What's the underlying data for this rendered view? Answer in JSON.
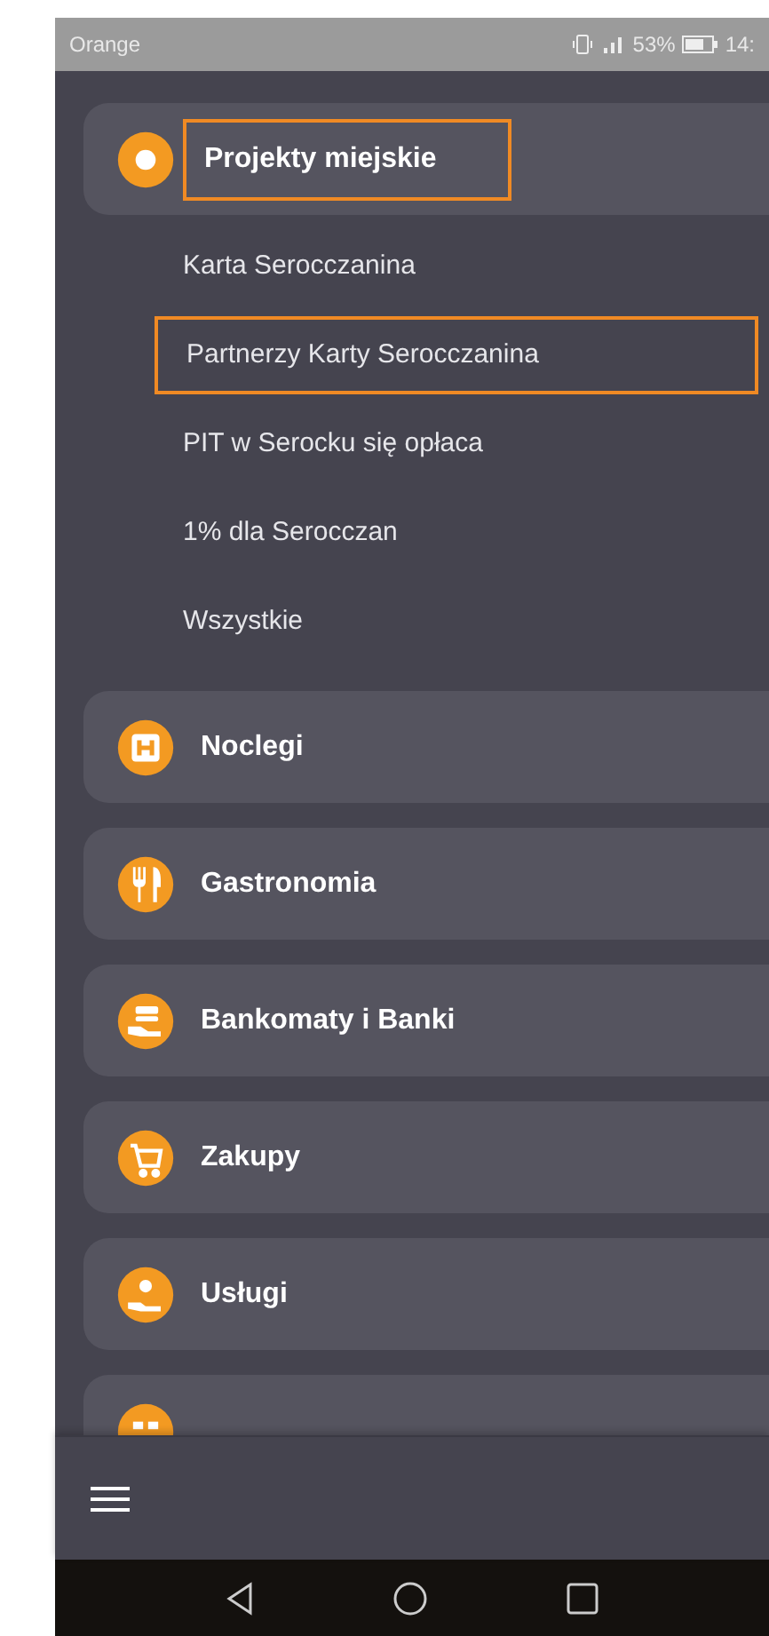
{
  "status_bar": {
    "carrier": "Orange",
    "battery": "53%",
    "time": "14:"
  },
  "categories": [
    {
      "kind": "target",
      "label": "Projekty miejskie",
      "highlighted": true,
      "children": [
        {
          "label": "Karta Serocczanina",
          "highlighted": false
        },
        {
          "label": "Partnerzy Karty Serocczanina",
          "highlighted": true
        },
        {
          "label": "PIT w Serocku się opłaca",
          "highlighted": false
        },
        {
          "label": "1% dla Serocczan",
          "highlighted": false
        },
        {
          "label": "Wszystkie",
          "highlighted": false
        }
      ]
    },
    {
      "kind": "hotel",
      "label": "Noclegi"
    },
    {
      "kind": "food",
      "label": "Gastronomia"
    },
    {
      "kind": "bank",
      "label": "Bankomaty i Banki"
    },
    {
      "kind": "cart",
      "label": "Zakupy"
    },
    {
      "kind": "service",
      "label": "Usługi"
    },
    {
      "kind": "grid"
    }
  ]
}
